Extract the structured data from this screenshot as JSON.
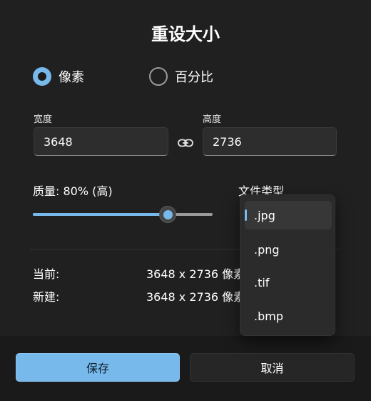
{
  "dialog": {
    "title": "重设大小"
  },
  "mode": {
    "options": [
      {
        "label": "像素",
        "selected": true
      },
      {
        "label": "百分比",
        "selected": false
      }
    ]
  },
  "size": {
    "width_label": "宽度",
    "width_value": "3648",
    "height_label": "高度",
    "height_value": "2736",
    "link_icon": "link-icon"
  },
  "quality": {
    "label": "质量: 80% (高)",
    "value_percent": 80
  },
  "file_type": {
    "label": "文件类型",
    "options": [
      ".jpg",
      ".png",
      ".tif",
      ".bmp"
    ],
    "selected": ".jpg"
  },
  "info": {
    "current_label": "当前:",
    "current_value": "3648 x 2736 像素",
    "new_label": "新建:",
    "new_value": "3648 x 2736 像素"
  },
  "buttons": {
    "save": "保存",
    "cancel": "取消"
  },
  "colors": {
    "accent": "#78b9ec",
    "background": "#202020",
    "footer": "#1a1a1a"
  }
}
